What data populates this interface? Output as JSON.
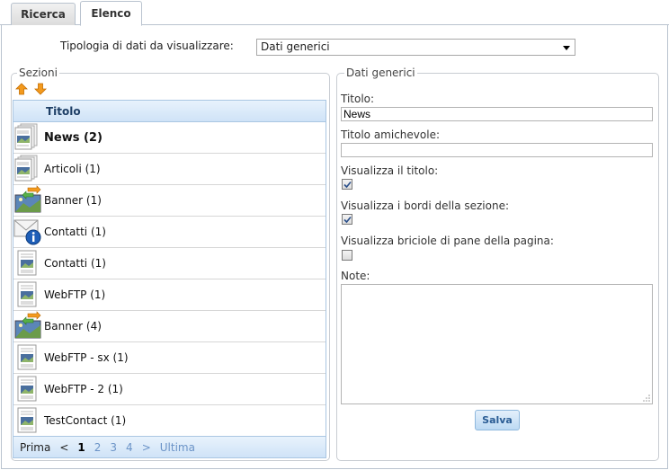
{
  "tabs": [
    {
      "label": "Ricerca"
    },
    {
      "label": "Elenco"
    }
  ],
  "tipologia": {
    "label": "Tipologia di dati da visualizzare:",
    "selected": "Dati generici"
  },
  "sezioni": {
    "legend": "Sezioni",
    "column_header": "Titolo",
    "rows": [
      {
        "title": "News (2)",
        "icon": "page-stack-icon"
      },
      {
        "title": "Articoli (1)",
        "icon": "page-stack-icon"
      },
      {
        "title": "Banner (1)",
        "icon": "banner-image-icon"
      },
      {
        "title": "Contatti (1)",
        "icon": "mail-info-icon"
      },
      {
        "title": "Contatti (1)",
        "icon": "page-image-icon"
      },
      {
        "title": "WebFTP (1)",
        "icon": "page-image-icon"
      },
      {
        "title": "Banner (4)",
        "icon": "banner-image-icon"
      },
      {
        "title": "WebFTP - sx (1)",
        "icon": "page-image-icon"
      },
      {
        "title": "WebFTP - 2 (1)",
        "icon": "page-image-icon"
      },
      {
        "title": "TestContact (1)",
        "icon": "page-image-icon"
      }
    ],
    "pager": {
      "first": "Prima",
      "prev": "<",
      "pages": [
        "1",
        "2",
        "3",
        "4"
      ],
      "next": ">",
      "last": "Ultima"
    }
  },
  "dati": {
    "legend": "Dati generici",
    "titolo_label": "Titolo:",
    "titolo_value": "News",
    "amichevole_label": "Titolo amichevole:",
    "amichevole_value": "",
    "vis_titolo_label": "Visualizza il titolo:",
    "vis_titolo_checked": true,
    "vis_bordi_label": "Visualizza i bordi della sezione:",
    "vis_bordi_checked": true,
    "vis_briciole_label": "Visualizza briciole di pane della pagina:",
    "vis_briciole_checked": false,
    "note_label": "Note:",
    "note_value": "",
    "save_label": "Salva"
  },
  "colors": {
    "accent": "#6b93c7",
    "grid_border": "#aac6e2",
    "arrow": "#f39a1e"
  }
}
